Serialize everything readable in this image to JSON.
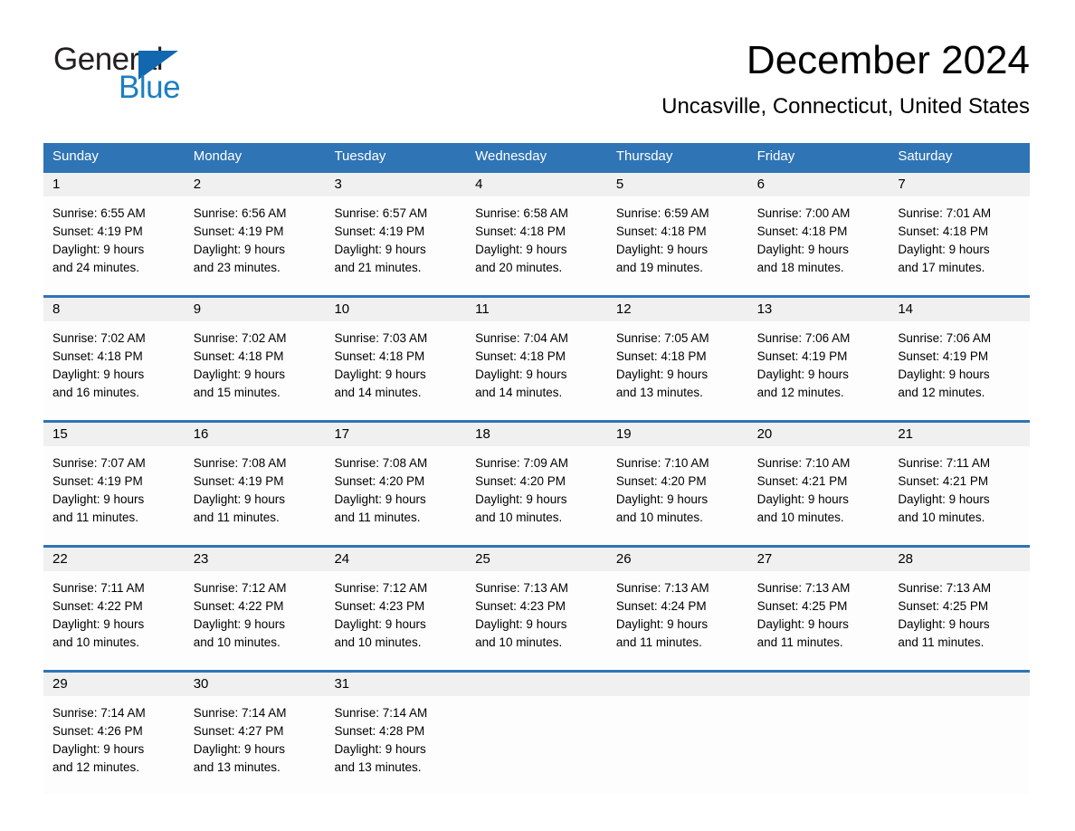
{
  "brand": {
    "name_part1": "General",
    "name_part2": "Blue",
    "triangle_color": "#1268ae",
    "blue_color": "#1a7fc1"
  },
  "header": {
    "title": "December 2024",
    "location": "Uncasville, Connecticut, United States"
  },
  "theme": {
    "header_blue": "#2f74b5",
    "date_band": "#f0f0f0",
    "cell_bg": "#fdfdfd",
    "text": "#000000"
  },
  "weekdays": [
    "Sunday",
    "Monday",
    "Tuesday",
    "Wednesday",
    "Thursday",
    "Friday",
    "Saturday"
  ],
  "weeks": [
    {
      "days": [
        {
          "date": "1",
          "sunrise": "Sunrise: 6:55 AM",
          "sunset": "Sunset: 4:19 PM",
          "daylight1": "Daylight: 9 hours",
          "daylight2": "and 24 minutes."
        },
        {
          "date": "2",
          "sunrise": "Sunrise: 6:56 AM",
          "sunset": "Sunset: 4:19 PM",
          "daylight1": "Daylight: 9 hours",
          "daylight2": "and 23 minutes."
        },
        {
          "date": "3",
          "sunrise": "Sunrise: 6:57 AM",
          "sunset": "Sunset: 4:19 PM",
          "daylight1": "Daylight: 9 hours",
          "daylight2": "and 21 minutes."
        },
        {
          "date": "4",
          "sunrise": "Sunrise: 6:58 AM",
          "sunset": "Sunset: 4:18 PM",
          "daylight1": "Daylight: 9 hours",
          "daylight2": "and 20 minutes."
        },
        {
          "date": "5",
          "sunrise": "Sunrise: 6:59 AM",
          "sunset": "Sunset: 4:18 PM",
          "daylight1": "Daylight: 9 hours",
          "daylight2": "and 19 minutes."
        },
        {
          "date": "6",
          "sunrise": "Sunrise: 7:00 AM",
          "sunset": "Sunset: 4:18 PM",
          "daylight1": "Daylight: 9 hours",
          "daylight2": "and 18 minutes."
        },
        {
          "date": "7",
          "sunrise": "Sunrise: 7:01 AM",
          "sunset": "Sunset: 4:18 PM",
          "daylight1": "Daylight: 9 hours",
          "daylight2": "and 17 minutes."
        }
      ]
    },
    {
      "days": [
        {
          "date": "8",
          "sunrise": "Sunrise: 7:02 AM",
          "sunset": "Sunset: 4:18 PM",
          "daylight1": "Daylight: 9 hours",
          "daylight2": "and 16 minutes."
        },
        {
          "date": "9",
          "sunrise": "Sunrise: 7:02 AM",
          "sunset": "Sunset: 4:18 PM",
          "daylight1": "Daylight: 9 hours",
          "daylight2": "and 15 minutes."
        },
        {
          "date": "10",
          "sunrise": "Sunrise: 7:03 AM",
          "sunset": "Sunset: 4:18 PM",
          "daylight1": "Daylight: 9 hours",
          "daylight2": "and 14 minutes."
        },
        {
          "date": "11",
          "sunrise": "Sunrise: 7:04 AM",
          "sunset": "Sunset: 4:18 PM",
          "daylight1": "Daylight: 9 hours",
          "daylight2": "and 14 minutes."
        },
        {
          "date": "12",
          "sunrise": "Sunrise: 7:05 AM",
          "sunset": "Sunset: 4:18 PM",
          "daylight1": "Daylight: 9 hours",
          "daylight2": "and 13 minutes."
        },
        {
          "date": "13",
          "sunrise": "Sunrise: 7:06 AM",
          "sunset": "Sunset: 4:19 PM",
          "daylight1": "Daylight: 9 hours",
          "daylight2": "and 12 minutes."
        },
        {
          "date": "14",
          "sunrise": "Sunrise: 7:06 AM",
          "sunset": "Sunset: 4:19 PM",
          "daylight1": "Daylight: 9 hours",
          "daylight2": "and 12 minutes."
        }
      ]
    },
    {
      "days": [
        {
          "date": "15",
          "sunrise": "Sunrise: 7:07 AM",
          "sunset": "Sunset: 4:19 PM",
          "daylight1": "Daylight: 9 hours",
          "daylight2": "and 11 minutes."
        },
        {
          "date": "16",
          "sunrise": "Sunrise: 7:08 AM",
          "sunset": "Sunset: 4:19 PM",
          "daylight1": "Daylight: 9 hours",
          "daylight2": "and 11 minutes."
        },
        {
          "date": "17",
          "sunrise": "Sunrise: 7:08 AM",
          "sunset": "Sunset: 4:20 PM",
          "daylight1": "Daylight: 9 hours",
          "daylight2": "and 11 minutes."
        },
        {
          "date": "18",
          "sunrise": "Sunrise: 7:09 AM",
          "sunset": "Sunset: 4:20 PM",
          "daylight1": "Daylight: 9 hours",
          "daylight2": "and 10 minutes."
        },
        {
          "date": "19",
          "sunrise": "Sunrise: 7:10 AM",
          "sunset": "Sunset: 4:20 PM",
          "daylight1": "Daylight: 9 hours",
          "daylight2": "and 10 minutes."
        },
        {
          "date": "20",
          "sunrise": "Sunrise: 7:10 AM",
          "sunset": "Sunset: 4:21 PM",
          "daylight1": "Daylight: 9 hours",
          "daylight2": "and 10 minutes."
        },
        {
          "date": "21",
          "sunrise": "Sunrise: 7:11 AM",
          "sunset": "Sunset: 4:21 PM",
          "daylight1": "Daylight: 9 hours",
          "daylight2": "and 10 minutes."
        }
      ]
    },
    {
      "days": [
        {
          "date": "22",
          "sunrise": "Sunrise: 7:11 AM",
          "sunset": "Sunset: 4:22 PM",
          "daylight1": "Daylight: 9 hours",
          "daylight2": "and 10 minutes."
        },
        {
          "date": "23",
          "sunrise": "Sunrise: 7:12 AM",
          "sunset": "Sunset: 4:22 PM",
          "daylight1": "Daylight: 9 hours",
          "daylight2": "and 10 minutes."
        },
        {
          "date": "24",
          "sunrise": "Sunrise: 7:12 AM",
          "sunset": "Sunset: 4:23 PM",
          "daylight1": "Daylight: 9 hours",
          "daylight2": "and 10 minutes."
        },
        {
          "date": "25",
          "sunrise": "Sunrise: 7:13 AM",
          "sunset": "Sunset: 4:23 PM",
          "daylight1": "Daylight: 9 hours",
          "daylight2": "and 10 minutes."
        },
        {
          "date": "26",
          "sunrise": "Sunrise: 7:13 AM",
          "sunset": "Sunset: 4:24 PM",
          "daylight1": "Daylight: 9 hours",
          "daylight2": "and 11 minutes."
        },
        {
          "date": "27",
          "sunrise": "Sunrise: 7:13 AM",
          "sunset": "Sunset: 4:25 PM",
          "daylight1": "Daylight: 9 hours",
          "daylight2": "and 11 minutes."
        },
        {
          "date": "28",
          "sunrise": "Sunrise: 7:13 AM",
          "sunset": "Sunset: 4:25 PM",
          "daylight1": "Daylight: 9 hours",
          "daylight2": "and 11 minutes."
        }
      ]
    },
    {
      "days": [
        {
          "date": "29",
          "sunrise": "Sunrise: 7:14 AM",
          "sunset": "Sunset: 4:26 PM",
          "daylight1": "Daylight: 9 hours",
          "daylight2": "and 12 minutes."
        },
        {
          "date": "30",
          "sunrise": "Sunrise: 7:14 AM",
          "sunset": "Sunset: 4:27 PM",
          "daylight1": "Daylight: 9 hours",
          "daylight2": "and 13 minutes."
        },
        {
          "date": "31",
          "sunrise": "Sunrise: 7:14 AM",
          "sunset": "Sunset: 4:28 PM",
          "daylight1": "Daylight: 9 hours",
          "daylight2": "and 13 minutes."
        },
        {
          "date": "",
          "sunrise": "",
          "sunset": "",
          "daylight1": "",
          "daylight2": ""
        },
        {
          "date": "",
          "sunrise": "",
          "sunset": "",
          "daylight1": "",
          "daylight2": ""
        },
        {
          "date": "",
          "sunrise": "",
          "sunset": "",
          "daylight1": "",
          "daylight2": ""
        },
        {
          "date": "",
          "sunrise": "",
          "sunset": "",
          "daylight1": "",
          "daylight2": ""
        }
      ]
    }
  ]
}
